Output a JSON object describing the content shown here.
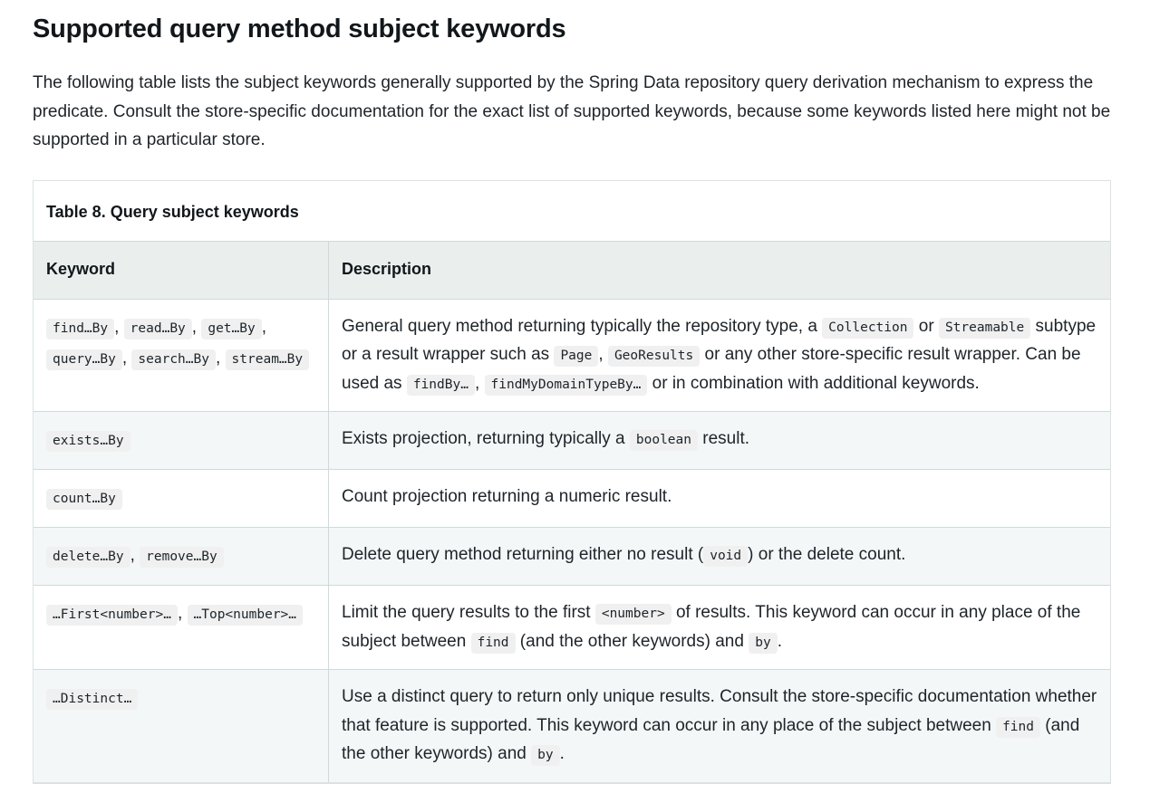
{
  "page": {
    "title": "Supported query method subject keywords",
    "intro": "The following table lists the subject keywords generally supported by the Spring Data repository query derivation mechanism to express the predicate. Consult the store-specific documentation for the exact list of supported keywords, because some keywords listed here might not be supported in a particular store."
  },
  "colors": {
    "page_background": "#ffffff",
    "text": "#1d2429",
    "heading": "#11171b",
    "table_border": "#cfd9db",
    "table_outer_border": "#dbe2e4",
    "header_row_background": "#eaefee",
    "alt_row_background": "#f4f7f8",
    "code_chip_background": "#f0f0f0"
  },
  "table": {
    "caption": "Table 8. Query subject keywords",
    "columns": [
      {
        "label": "Keyword"
      },
      {
        "label": "Description"
      }
    ],
    "rows": [
      {
        "keyword_parts": [
          {
            "type": "code",
            "text": "find…By"
          },
          {
            "type": "text",
            "text": ", "
          },
          {
            "type": "code",
            "text": "read…By"
          },
          {
            "type": "text",
            "text": ", "
          },
          {
            "type": "code",
            "text": "get…By"
          },
          {
            "type": "text",
            "text": ", "
          },
          {
            "type": "code",
            "text": "query…By"
          },
          {
            "type": "text",
            "text": ", "
          },
          {
            "type": "code",
            "text": "search…By"
          },
          {
            "type": "text",
            "text": ", "
          },
          {
            "type": "code",
            "text": "stream…By"
          }
        ],
        "description_parts": [
          {
            "type": "text",
            "text": "General query method returning typically the repository type, a "
          },
          {
            "type": "code",
            "text": "Collection"
          },
          {
            "type": "text",
            "text": " or "
          },
          {
            "type": "code",
            "text": "Streamable"
          },
          {
            "type": "text",
            "text": " subtype or a result wrapper such as "
          },
          {
            "type": "code",
            "text": "Page"
          },
          {
            "type": "text",
            "text": ", "
          },
          {
            "type": "code",
            "text": "GeoResults"
          },
          {
            "type": "text",
            "text": " or any other store-specific result wrapper. Can be used as "
          },
          {
            "type": "code",
            "text": "findBy…"
          },
          {
            "type": "text",
            "text": ", "
          },
          {
            "type": "code",
            "text": "findMyDomainTypeBy…"
          },
          {
            "type": "text",
            "text": " or in combination with additional keywords."
          }
        ]
      },
      {
        "keyword_parts": [
          {
            "type": "code",
            "text": "exists…By"
          }
        ],
        "description_parts": [
          {
            "type": "text",
            "text": "Exists projection, returning typically a "
          },
          {
            "type": "code",
            "text": "boolean"
          },
          {
            "type": "text",
            "text": " result."
          }
        ]
      },
      {
        "keyword_parts": [
          {
            "type": "code",
            "text": "count…By"
          }
        ],
        "description_parts": [
          {
            "type": "text",
            "text": "Count projection returning a numeric result."
          }
        ]
      },
      {
        "keyword_parts": [
          {
            "type": "code",
            "text": "delete…By"
          },
          {
            "type": "text",
            "text": ", "
          },
          {
            "type": "code",
            "text": "remove…By"
          }
        ],
        "description_parts": [
          {
            "type": "text",
            "text": "Delete query method returning either no result ("
          },
          {
            "type": "code",
            "text": "void"
          },
          {
            "type": "text",
            "text": ") or the delete count."
          }
        ]
      },
      {
        "keyword_parts": [
          {
            "type": "code",
            "text": "…First<number>…"
          },
          {
            "type": "text",
            "text": ", "
          },
          {
            "type": "code",
            "text": "…Top<number>…"
          }
        ],
        "description_parts": [
          {
            "type": "text",
            "text": "Limit the query results to the first "
          },
          {
            "type": "code",
            "text": "<number>"
          },
          {
            "type": "text",
            "text": " of results. This keyword can occur in any place of the subject between "
          },
          {
            "type": "code",
            "text": "find"
          },
          {
            "type": "text",
            "text": " (and the other keywords) and "
          },
          {
            "type": "code",
            "text": "by"
          },
          {
            "type": "text",
            "text": "."
          }
        ]
      },
      {
        "keyword_parts": [
          {
            "type": "code",
            "text": "…Distinct…"
          }
        ],
        "description_parts": [
          {
            "type": "text",
            "text": "Use a distinct query to return only unique results. Consult the store-specific documentation whether that feature is supported. This keyword can occur in any place of the subject between "
          },
          {
            "type": "code",
            "text": "find"
          },
          {
            "type": "text",
            "text": " (and the other keywords) and "
          },
          {
            "type": "code",
            "text": "by"
          },
          {
            "type": "text",
            "text": "."
          }
        ]
      }
    ]
  }
}
